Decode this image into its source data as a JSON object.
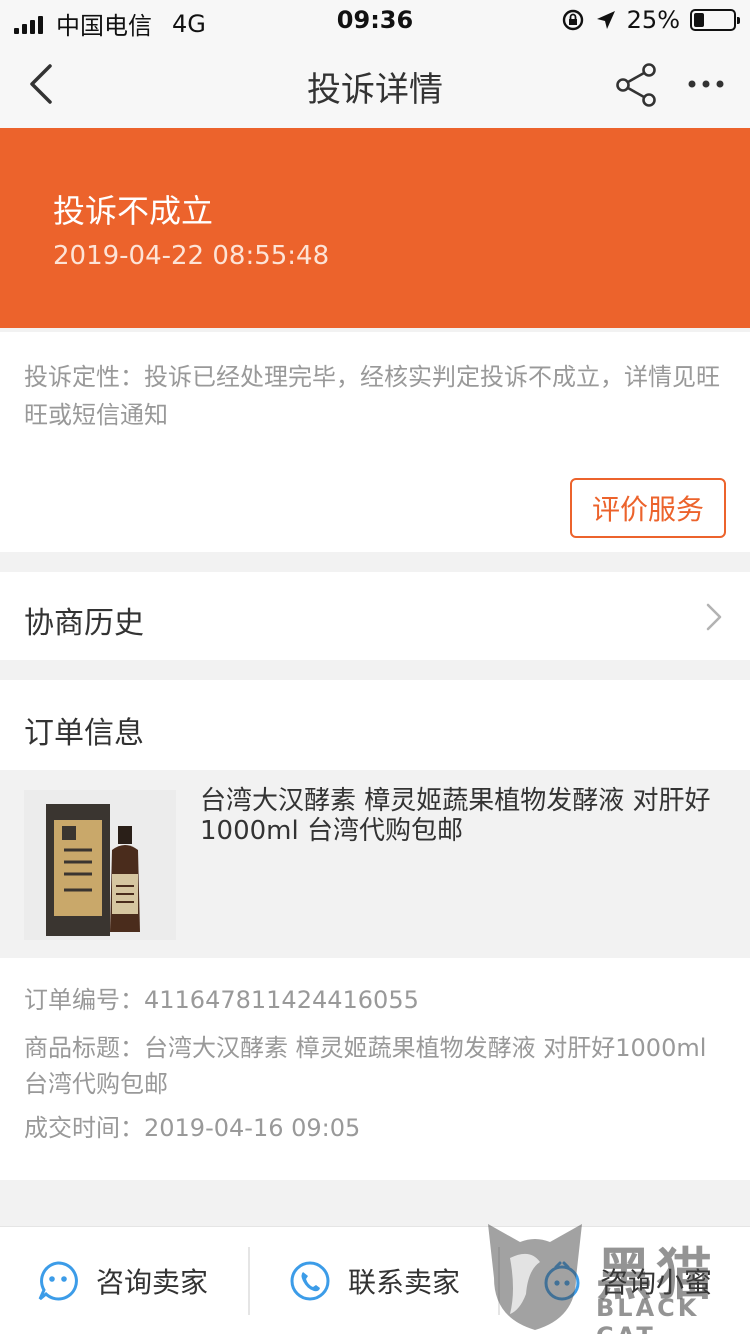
{
  "status_bar": {
    "carrier": "中国电信",
    "network": "4G",
    "time": "09:36",
    "battery_text": "25%",
    "battery_level": 0.25
  },
  "nav": {
    "title": "投诉详情",
    "icons": [
      "back-arrow-icon",
      "share-icon",
      "more-icon"
    ]
  },
  "banner": {
    "status": "投诉不成立",
    "timestamp": "2019-04-22 08:55:48",
    "color": "#ec632c"
  },
  "description": {
    "text": "投诉定性：投诉已经处理完毕，经核实判定投诉不成立，详情见旺旺或短信通知",
    "rate_button": "评价服务"
  },
  "history": {
    "label": "协商历史"
  },
  "order": {
    "header": "订单信息",
    "product_title": "台湾大汉酵素 樟灵姬蔬果植物发酵液 对肝好1000ml 台湾代购包邮",
    "order_number_label": "订单编号：",
    "order_number": "411647811424416055",
    "item_title_label": "商品标题：",
    "item_title": "台湾大汉酵素 樟灵姬蔬果植物发酵液 对肝好1000ml 台湾代购包邮",
    "deal_time_label": "成交时间：",
    "deal_time": "2019-04-16 09:05"
  },
  "bottom_bar": {
    "items": [
      {
        "label": "咨询卖家",
        "icon": "chat-face-icon"
      },
      {
        "label": "联系卖家",
        "icon": "phone-icon"
      },
      {
        "label": "咨询小蜜",
        "icon": "assistant-icon"
      }
    ]
  },
  "watermark": {
    "cn": "黑猫",
    "en": "BLACK CAT"
  }
}
